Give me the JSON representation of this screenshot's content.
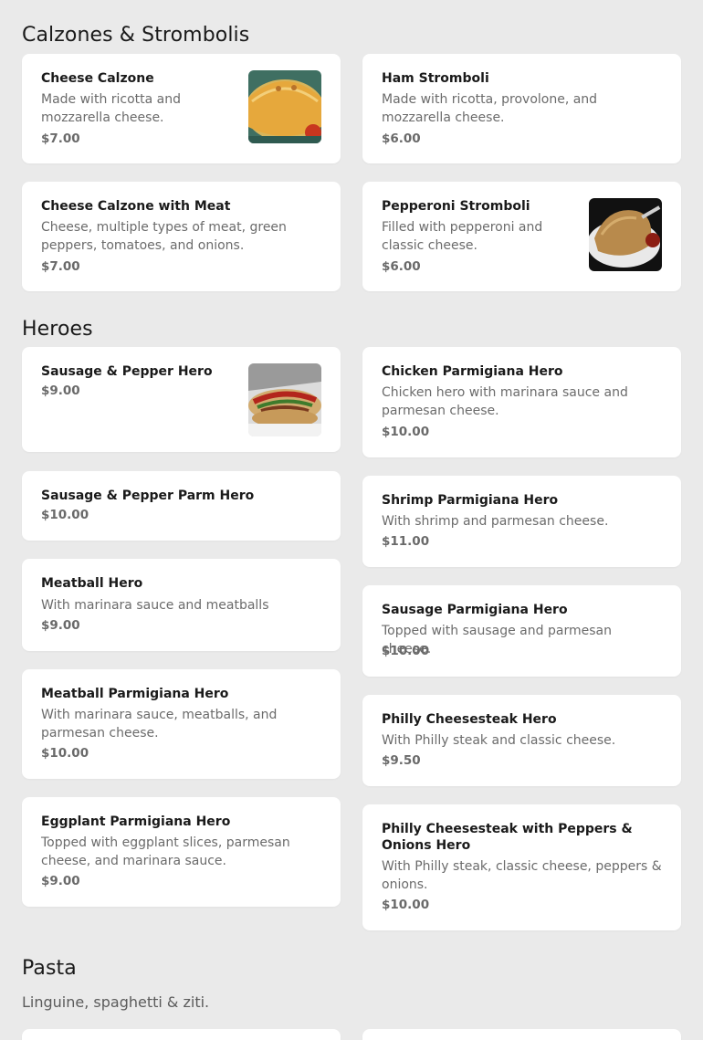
{
  "sections": [
    {
      "title": "Calzones & Strombolis",
      "items": [
        {
          "name": "Cheese Calzone",
          "description": "Made with ricotta and mozzarella cheese.",
          "price": "$7.00",
          "image": "calzone-photo"
        },
        {
          "name": "Ham Stromboli",
          "description": "Made with ricotta, provolone, and mozzarella cheese.",
          "price": "$6.00"
        },
        {
          "name": "Cheese Calzone with Meat",
          "description": "Cheese, multiple types of meat, green peppers, tomatoes, and onions.",
          "price": "$7.00"
        },
        {
          "name": "Pepperoni Stromboli",
          "description": "Filled with pepperoni and classic cheese.",
          "price": "$6.00",
          "image": "stromboli-photo"
        }
      ]
    },
    {
      "title": "Heroes",
      "items": [
        {
          "name": "Sausage & Pepper Hero",
          "price": "$9.00",
          "image": "sausage-hero-photo"
        },
        {
          "name": "Chicken Parmigiana Hero",
          "description": "Chicken hero with marinara sauce and parmesan cheese.",
          "price": "$10.00"
        },
        {
          "name": "Sausage & Pepper Parm Hero",
          "price": "$10.00"
        },
        {
          "name": "Shrimp Parmigiana Hero",
          "description": "With shrimp and parmesan cheese.",
          "price": "$11.00"
        },
        {
          "name": "Meatball Hero",
          "description": "With marinara sauce and meatballs",
          "price": "$9.00"
        },
        {
          "name": "Sausage Parmigiana Hero",
          "description": "Topped with sausage and parmesan cheese.",
          "price": "$10.00"
        },
        {
          "name": "Meatball Parmigiana Hero",
          "description": "With marinara sauce, meatballs, and parmesan cheese.",
          "price": "$10.00"
        },
        {
          "name": "Philly Cheesesteak Hero",
          "description": "With Philly steak and classic cheese.",
          "price": "$9.50"
        },
        {
          "name": "Eggplant Parmigiana Hero",
          "description": "Topped with eggplant slices, parmesan cheese, and marinara sauce.",
          "price": "$9.00"
        },
        {
          "name": "Philly Cheesesteak with Peppers & Onions Hero",
          "description": "With Philly steak, classic cheese, peppers & onions.",
          "price": "$10.00"
        }
      ]
    },
    {
      "title": "Pasta",
      "subtitle": "Linguine, spaghetti & ziti."
    }
  ]
}
